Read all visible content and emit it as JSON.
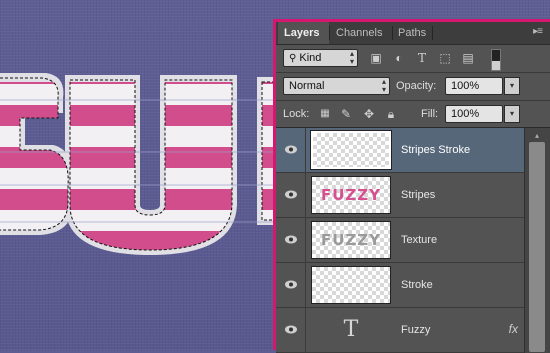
{
  "panel": {
    "tabs": [
      {
        "label": "Layers",
        "active": true
      },
      {
        "label": "Channels",
        "active": false
      },
      {
        "label": "Paths",
        "active": false
      }
    ],
    "menu_icon": "panel-menu-icon",
    "filter": {
      "label": "Kind",
      "icon": "search-icon"
    },
    "filter_icons": [
      "image-filter-icon",
      "adjustment-filter-icon",
      "type-filter-icon",
      "shape-filter-icon",
      "smart-object-filter-icon",
      "filter-toggle-icon"
    ],
    "blend_mode": "Normal",
    "opacity": {
      "label": "Opacity:",
      "value": "100%"
    },
    "lock": {
      "label": "Lock:",
      "icons": [
        "lock-transparency-icon",
        "lock-image-icon",
        "lock-position-icon",
        "lock-all-icon"
      ]
    },
    "fill": {
      "label": "Fill:",
      "value": "100%"
    },
    "layers": [
      {
        "name": "Stripes Stroke",
        "selected": true,
        "visible": true,
        "thumb": "checker",
        "thumb_text": ""
      },
      {
        "name": "Stripes",
        "selected": false,
        "visible": true,
        "thumb": "text",
        "thumb_text": "FUZZY"
      },
      {
        "name": "Texture",
        "selected": false,
        "visible": true,
        "thumb": "text",
        "thumb_text": "FUZZY"
      },
      {
        "name": "Stroke",
        "selected": false,
        "visible": true,
        "thumb": "checker",
        "thumb_text": ""
      },
      {
        "name": "Fuzzy",
        "selected": false,
        "visible": true,
        "thumb": "type",
        "thumb_text": "T",
        "fx": "fx"
      }
    ]
  },
  "colors": {
    "canvas_bg": "#5d5d93",
    "panel_bg": "#535353",
    "panel_border": "#d5186f",
    "selected_row": "#57677a",
    "stripe_pink": "#d0508c",
    "fuzzy_white": "#f3f3f3"
  }
}
